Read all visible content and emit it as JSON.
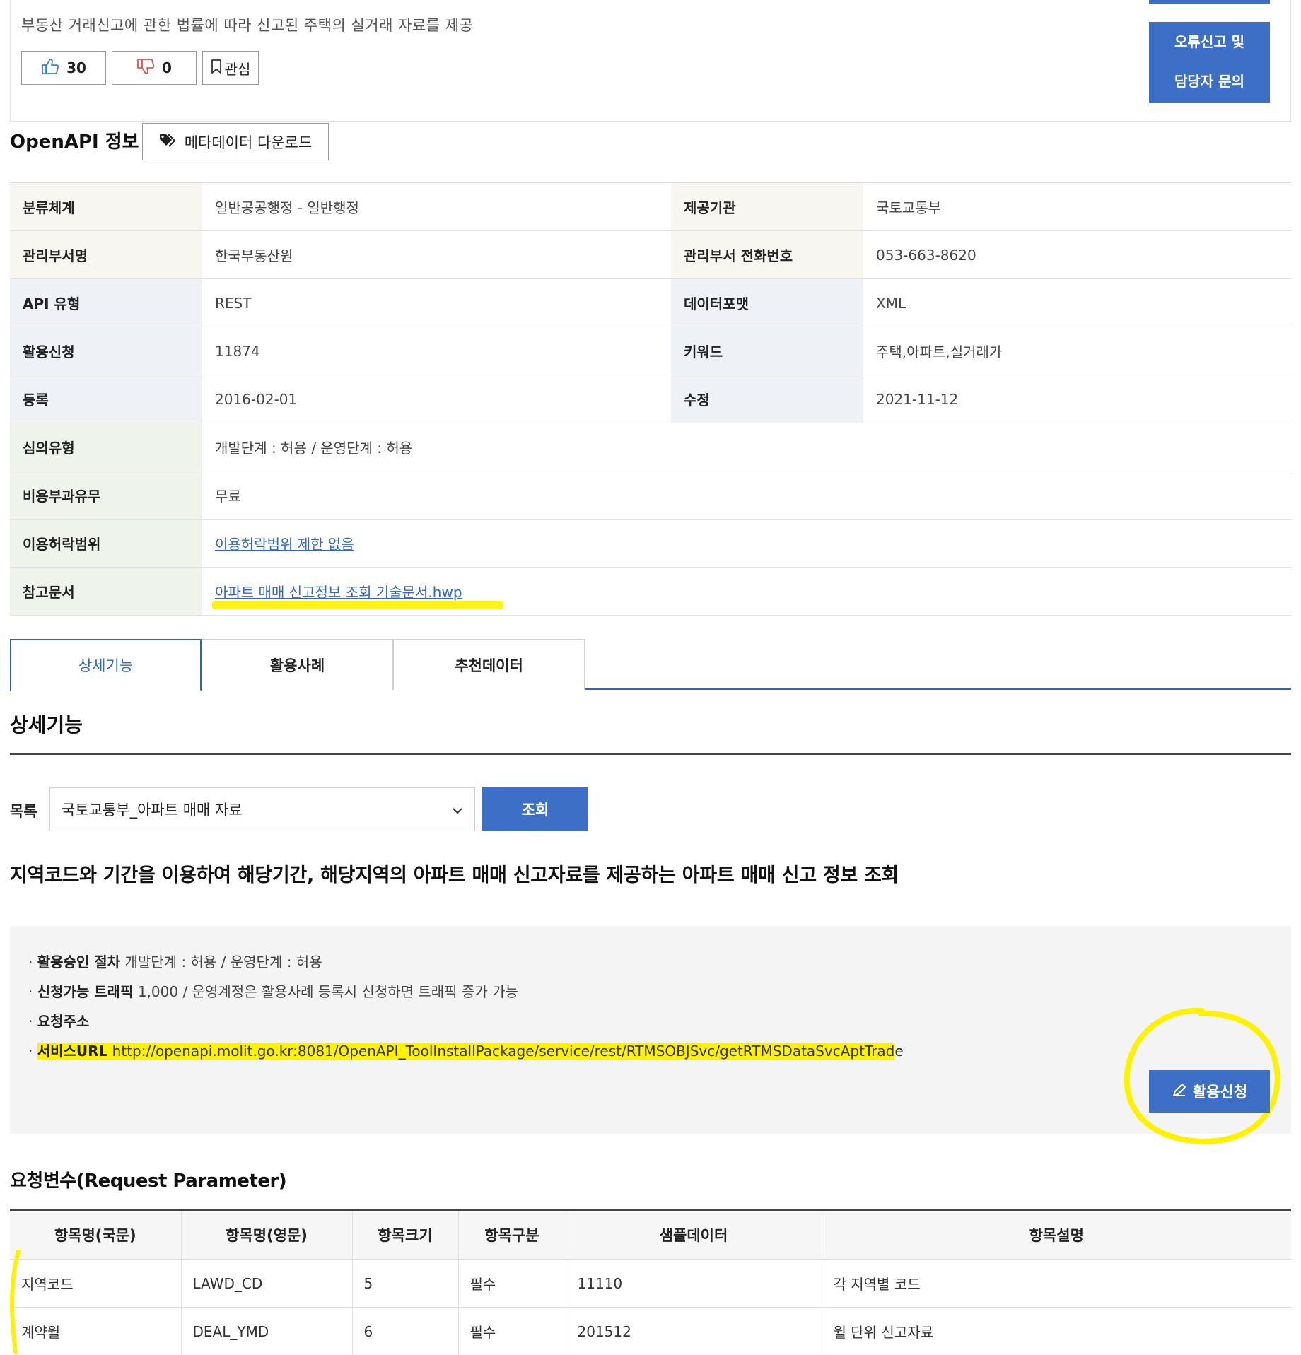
{
  "summary": {
    "description": "부동산 거래신고에 관한 법률에 따라 신고된 주택의 실거래 자료를 제공",
    "like_count": "30",
    "dislike_count": "0",
    "favorite_label": "관심",
    "report_button": [
      "오류신고 및",
      "담당자 문의"
    ]
  },
  "openapi": {
    "title": "OpenAPI 정보",
    "metadata_button": "메타데이터 다운로드"
  },
  "info": {
    "classification_label": "분류체계",
    "classification": "일반공공행정 - 일반행정",
    "provider_label": "제공기관",
    "provider": "국토교통부",
    "dept_label": "관리부서명",
    "dept": "한국부동산원",
    "phone_label": "관리부서 전화번호",
    "phone": "053-663-8620",
    "api_type_label": "API 유형",
    "api_type": "REST",
    "format_label": "데이터포맷",
    "format": "XML",
    "applications_label": "활용신청",
    "applications": "11874",
    "keywords_label": "키워드",
    "keywords": "주택,아파트,실거래가",
    "registered_label": "등록",
    "registered": "2016-02-01",
    "modified_label": "수정",
    "modified": "2021-11-12",
    "review_label": "심의유형",
    "review": "개발단계 : 허용 / 운영단계 : 허용",
    "fee_label": "비용부과유무",
    "fee": "무료",
    "license_label": "이용허락범위",
    "license": "이용허락범위 제한 없음",
    "reference_label": "참고문서",
    "reference": "아파트 매매 신고정보 조회 기술문서.hwp"
  },
  "tabs": [
    "상세기능",
    "활용사례",
    "추천데이터"
  ],
  "detail": {
    "title": "상세기능",
    "list_label": "목록",
    "list_selected": "국토교통부_아파트 매매 자료",
    "query_button": "조회",
    "operation_description": "지역코드와 기간을 이용하여 해당기간, 해당지역의 아파트 매매 신고자료를 제공하는 아파트 매매 신고 정보 조회",
    "approval_label": "활용승인 절차",
    "approval_value": "개발단계 : 허용 / 운영단계 : 허용",
    "traffic_label": "신청가능 트래픽",
    "traffic_value": "1,000 / 운영계정은 활용사례 등록시 신청하면 트래픽 증가 가능",
    "request_address_label": "요청주소",
    "service_url_label": "서비스URL",
    "service_url_main": "http://openapi.molit.go.kr:8081/OpenAPI_ToolInstallPackage/service/rest/RTMSOBJSvc/getRTMSDataSvcAptTrad",
    "service_url_tail": "e",
    "apply_button": "활용신청"
  },
  "request": {
    "title": "요청변수(Request Parameter)",
    "headers": [
      "항목명(국문)",
      "항목명(영문)",
      "항목크기",
      "항목구분",
      "샘플데이터",
      "항목설명"
    ],
    "rows": [
      [
        "지역코드",
        "LAWD_CD",
        "5",
        "필수",
        "11110",
        "각 지역별 코드"
      ],
      [
        "계약월",
        "DEAL_YMD",
        "6",
        "필수",
        "201512",
        "월 단위 신고자료"
      ]
    ]
  },
  "colors": {
    "accent": "#3d6fc7",
    "highlight": "#fff200",
    "link": "#2f68c4"
  }
}
